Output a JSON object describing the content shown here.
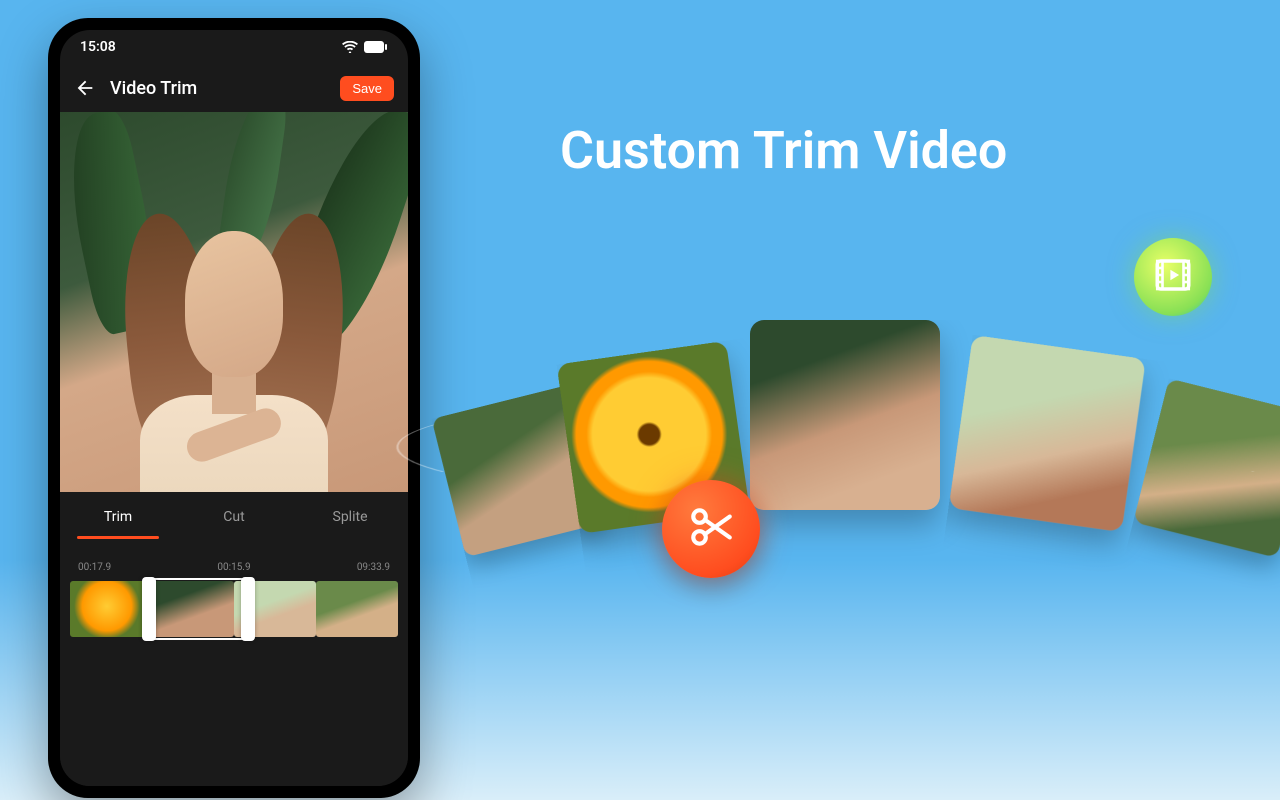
{
  "phone": {
    "status": {
      "time": "15:08"
    },
    "header": {
      "title": "Video Trim",
      "save_label": "Save"
    },
    "tabs": [
      {
        "label": "Trim",
        "active": true
      },
      {
        "label": "Cut",
        "active": false
      },
      {
        "label": "Splite",
        "active": false
      }
    ],
    "timeline": {
      "times": [
        "00:17.9",
        "00:15.9",
        "09:33.9"
      ]
    }
  },
  "marketing": {
    "headline": "Custom Trim Video"
  },
  "icons": {
    "back": "back-arrow-icon",
    "wifi": "wifi-icon",
    "battery": "battery-icon",
    "scissors": "scissors-icon",
    "film": "film-play-icon"
  },
  "colors": {
    "accent": "#ff4d1f",
    "bg_sky": "#58b5ef"
  }
}
